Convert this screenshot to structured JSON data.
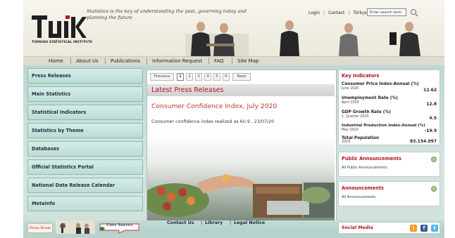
{
  "header": {
    "tagline": "Statistics is the key of understanding the past, governing today and planning the future",
    "logo_subtitle": "TURKISH STATISTICAL INSTITUTE",
    "top_links": [
      "Login",
      "Contact",
      "Türkçe"
    ],
    "search_placeholder": "Enter search term."
  },
  "nav": {
    "items": [
      "Home",
      "About Us",
      "Publications",
      "Information Request",
      "FAQ",
      "Site Map"
    ]
  },
  "sidebar": {
    "items": [
      "Press Releases",
      "Main Statistics",
      "Statistical Indicators",
      "Statistics by Theme",
      "Databases",
      "Official Statistics Portal",
      "National Data Release Calendar",
      "MetaInfo"
    ]
  },
  "center": {
    "pager": {
      "previous": "Previous",
      "pages": [
        "1",
        "2",
        "3",
        "4",
        "5",
        "6"
      ],
      "active_page": "1",
      "next": "Next"
    },
    "section_title": "Latest Press Releases",
    "headline": "Consumer Confidence Index, July 2020",
    "summary": "Consumer confidence index realized as 60.9 ,  23/07/20"
  },
  "key_indicators": {
    "title": "Key Indicators",
    "items": [
      {
        "label": "Consumer Price Index-Annual (%)",
        "period": "June 2020",
        "value": "12.62"
      },
      {
        "label": "Unemployment Rate (%)",
        "period": "April 2020",
        "value": "12.8"
      },
      {
        "label": "GDP Growth Rate (%)",
        "period": "1. Quarter 2020",
        "value": "4.5"
      },
      {
        "label": "Industrial Production Index-Annual (%)",
        "period": "May 2020",
        "value": "-19.9"
      },
      {
        "label": "Total Population",
        "period": "2019",
        "value": "83.154.997"
      }
    ]
  },
  "public_announcements": {
    "title": "Public Announcements",
    "link": "All Public Announcements"
  },
  "announcements": {
    "title": "Announcements",
    "link": "All Announcements"
  },
  "footer": {
    "press_room": "Press Room",
    "user_survey": "User Survey",
    "links": [
      "Contact Us",
      "Library",
      "Legal Notice"
    ],
    "social_title": "Social Media"
  },
  "colors": {
    "accent_red": "#b1121f",
    "teal_background": "#bcd8d4",
    "sidebar_button": "#c9e4df"
  }
}
